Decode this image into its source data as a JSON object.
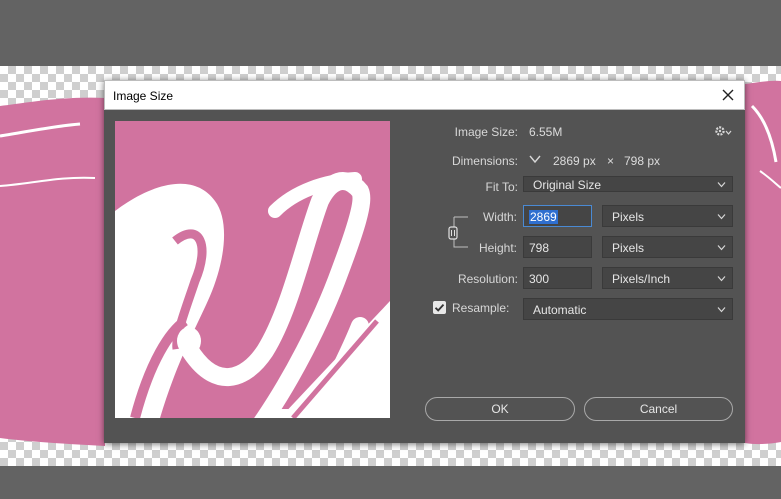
{
  "dialog": {
    "title": "Image Size",
    "image_size_label": "Image Size:",
    "image_size_value": "6.55M",
    "dimensions_label": "Dimensions:",
    "dimensions_width": "2869 px",
    "dimensions_times": "×",
    "dimensions_height": "798 px",
    "fit_to_label": "Fit To:",
    "fit_to_value": "Original Size",
    "width_label": "Width:",
    "width_value": "2869",
    "width_unit": "Pixels",
    "height_label": "Height:",
    "height_value": "798",
    "height_unit": "Pixels",
    "resolution_label": "Resolution:",
    "resolution_value": "300",
    "resolution_unit": "Pixels/Inch",
    "resample_label": "Resample:",
    "resample_checked": true,
    "resample_value": "Automatic",
    "ok_label": "OK",
    "cancel_label": "Cancel"
  },
  "colors": {
    "artwork_pink": "#d1739f",
    "dialog_bg": "#535353",
    "selection_blue": "#2f6fd0"
  },
  "icons": {
    "close": "close-icon",
    "gear": "gear-icon",
    "chevron": "chevron-down-icon",
    "link": "chain-link-icon",
    "check": "checkmark-icon"
  }
}
